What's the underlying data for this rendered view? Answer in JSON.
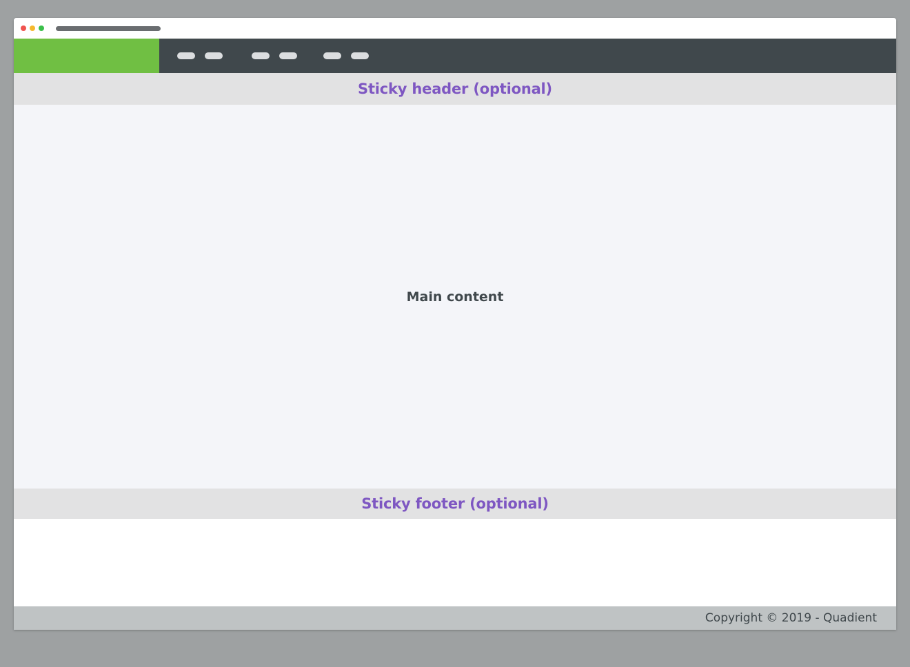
{
  "colors": {
    "close_dot": "#f0534f",
    "minimize_dot": "#f5b82e",
    "maximize_dot": "#3bbf4a",
    "brand_green": "#70bf43",
    "accent_purple": "#7e57c2"
  },
  "window": {
    "controls": [
      "close-dot",
      "minimize-dot",
      "maximize-dot"
    ]
  },
  "sticky_header": {
    "label": "Sticky header (optional)"
  },
  "main": {
    "label": "Main content"
  },
  "sticky_footer": {
    "label": "Sticky footer (optional)"
  },
  "footer": {
    "copyright": "Copyright © 2019 - Quadient"
  }
}
